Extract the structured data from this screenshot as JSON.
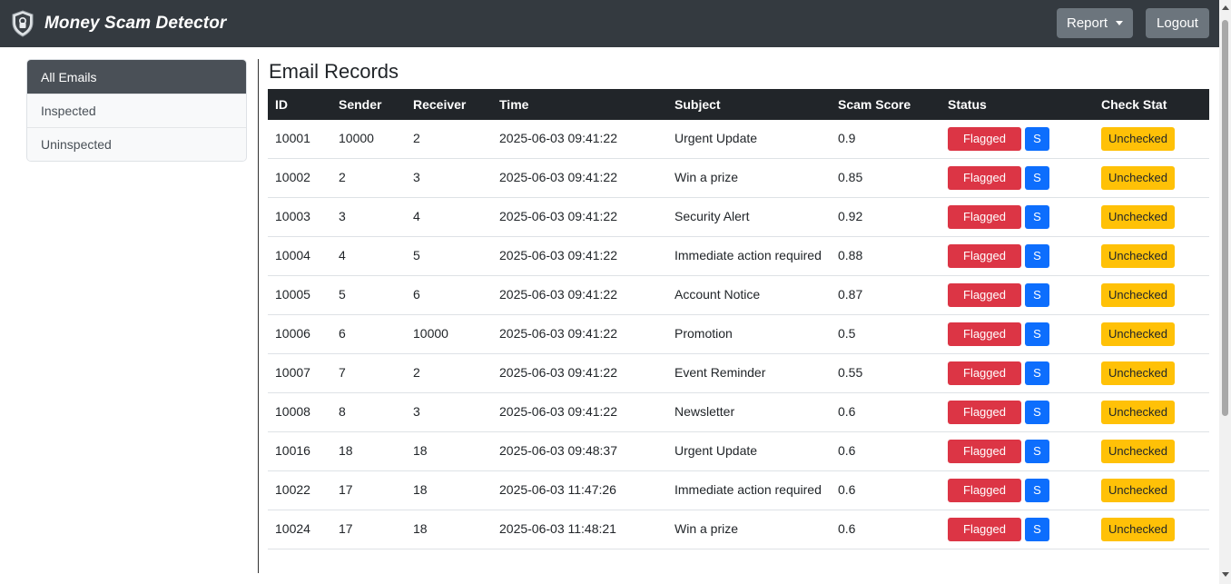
{
  "app": {
    "title": "Money Scam Detector"
  },
  "nav": {
    "report_label": "Report",
    "logout_label": "Logout"
  },
  "sidebar": {
    "items": [
      {
        "label": "All Emails",
        "active": true
      },
      {
        "label": "Inspected",
        "active": false
      },
      {
        "label": "Uninspected",
        "active": false
      }
    ]
  },
  "main": {
    "title": "Email Records",
    "columns": [
      "ID",
      "Sender",
      "Receiver",
      "Time",
      "Subject",
      "Scam Score",
      "Status",
      "Check Stat"
    ],
    "rows": [
      {
        "id": "10001",
        "sender": "10000",
        "receiver": "2",
        "time": "2025-06-03 09:41:22",
        "subject": "Urgent Update",
        "score": "0.9",
        "status": "Flagged",
        "s_label": "S",
        "check": "Unchecked"
      },
      {
        "id": "10002",
        "sender": "2",
        "receiver": "3",
        "time": "2025-06-03 09:41:22",
        "subject": "Win a prize",
        "score": "0.85",
        "status": "Flagged",
        "s_label": "S",
        "check": "Unchecked"
      },
      {
        "id": "10003",
        "sender": "3",
        "receiver": "4",
        "time": "2025-06-03 09:41:22",
        "subject": "Security Alert",
        "score": "0.92",
        "status": "Flagged",
        "s_label": "S",
        "check": "Unchecked"
      },
      {
        "id": "10004",
        "sender": "4",
        "receiver": "5",
        "time": "2025-06-03 09:41:22",
        "subject": "Immediate action required",
        "score": "0.88",
        "status": "Flagged",
        "s_label": "S",
        "check": "Unchecked"
      },
      {
        "id": "10005",
        "sender": "5",
        "receiver": "6",
        "time": "2025-06-03 09:41:22",
        "subject": "Account Notice",
        "score": "0.87",
        "status": "Flagged",
        "s_label": "S",
        "check": "Unchecked"
      },
      {
        "id": "10006",
        "sender": "6",
        "receiver": "10000",
        "time": "2025-06-03 09:41:22",
        "subject": "Promotion",
        "score": "0.5",
        "status": "Flagged",
        "s_label": "S",
        "check": "Unchecked"
      },
      {
        "id": "10007",
        "sender": "7",
        "receiver": "2",
        "time": "2025-06-03 09:41:22",
        "subject": "Event Reminder",
        "score": "0.55",
        "status": "Flagged",
        "s_label": "S",
        "check": "Unchecked"
      },
      {
        "id": "10008",
        "sender": "8",
        "receiver": "3",
        "time": "2025-06-03 09:41:22",
        "subject": "Newsletter",
        "score": "0.6",
        "status": "Flagged",
        "s_label": "S",
        "check": "Unchecked"
      },
      {
        "id": "10016",
        "sender": "18",
        "receiver": "18",
        "time": "2025-06-03 09:48:37",
        "subject": "Urgent Update",
        "score": "0.6",
        "status": "Flagged",
        "s_label": "S",
        "check": "Unchecked"
      },
      {
        "id": "10022",
        "sender": "17",
        "receiver": "18",
        "time": "2025-06-03 11:47:26",
        "subject": "Immediate action required",
        "score": "0.6",
        "status": "Flagged",
        "s_label": "S",
        "check": "Unchecked"
      },
      {
        "id": "10024",
        "sender": "17",
        "receiver": "18",
        "time": "2025-06-03 11:48:21",
        "subject": "Win a prize",
        "score": "0.6",
        "status": "Flagged",
        "s_label": "S",
        "check": "Unchecked"
      }
    ]
  },
  "icons": {
    "brand": "shield-lock-icon"
  },
  "colors": {
    "navbar": "#343a40",
    "flagged": "#dc3545",
    "s_button": "#0d6efd",
    "unchecked": "#ffc107",
    "table_header": "#212529"
  }
}
